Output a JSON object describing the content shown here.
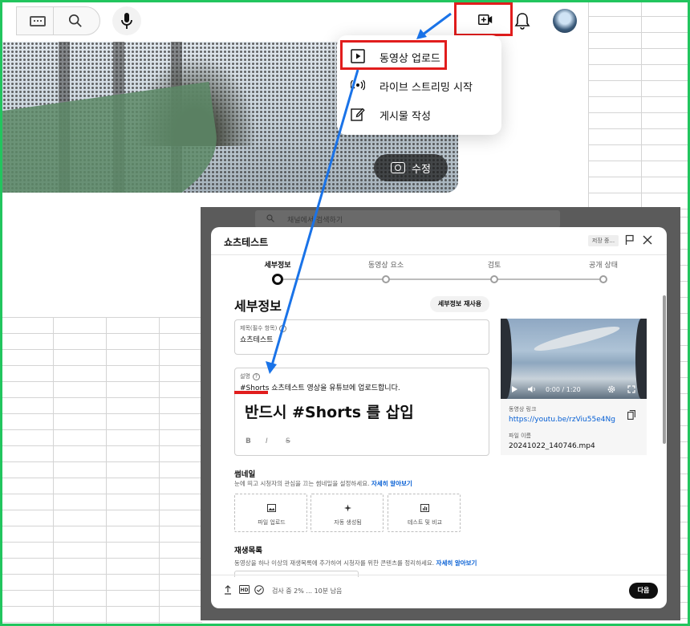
{
  "colors": {
    "annotation_red": "#e11d1d",
    "annotation_blue": "#1a73e8",
    "frame_green": "#22c55e",
    "link_blue": "#065fd4"
  },
  "top_bar": {
    "icons": [
      "keyboard-icon",
      "search-icon",
      "mic-icon",
      "create-video-icon",
      "bell-icon"
    ]
  },
  "banner": {
    "edit_label": "수정"
  },
  "create_menu": {
    "items": [
      {
        "label": "동영상 업로드",
        "icon": "upload-play-icon"
      },
      {
        "label": "라이브 스트리밍 시작",
        "icon": "live-icon"
      },
      {
        "label": "게시물 작성",
        "icon": "post-edit-icon"
      }
    ]
  },
  "stray_text": "라",
  "studio": {
    "search_placeholder": "채널에서 검색하기"
  },
  "dialog": {
    "title": "쇼츠테스트",
    "save_status": "저장 중...",
    "steps": [
      {
        "label": "세부정보",
        "active": true
      },
      {
        "label": "동영상 요소",
        "active": false
      },
      {
        "label": "검토",
        "active": false
      },
      {
        "label": "공개 상태",
        "active": false
      }
    ],
    "section_title": "세부정보",
    "reuse_label": "세부정보 재사용",
    "title_field": {
      "label": "제목(필수 항목)",
      "value": "쇼츠테스트"
    },
    "desc_field": {
      "label": "설명",
      "value": "#Shorts 쇼츠테스트 영상을 유튜브에 업로드합니다."
    },
    "format_buttons": [
      "B",
      "I",
      "S"
    ],
    "preview": {
      "time": "0:00 / 1:20"
    },
    "video_link_label": "동영상 링크",
    "video_link": "https://youtu.be/rzViu55e4Ng",
    "file_name_label": "파일 이름",
    "file_name": "20241022_140746.mp4",
    "thumbnail": {
      "title": "썸네일",
      "desc": "눈에 띄고 시청자의 관심을 끄는 썸네일을 설정하세요.",
      "learn_more": "자세히 알아보기",
      "options": [
        "파일 업로드",
        "자동 생성됨",
        "테스트 및 비교"
      ]
    },
    "playlist": {
      "title": "재생목록",
      "desc": "동영상을 하나 이상의 재생목록에 추가하여 시청자를 위한 콘텐츠를 정리하세요.",
      "learn_more": "자세히 알아보기"
    },
    "footer_status": "검사 중 2% ... 10분 남음",
    "next_label": "다음"
  },
  "callout": "반드시 #Shorts 를 삽입"
}
